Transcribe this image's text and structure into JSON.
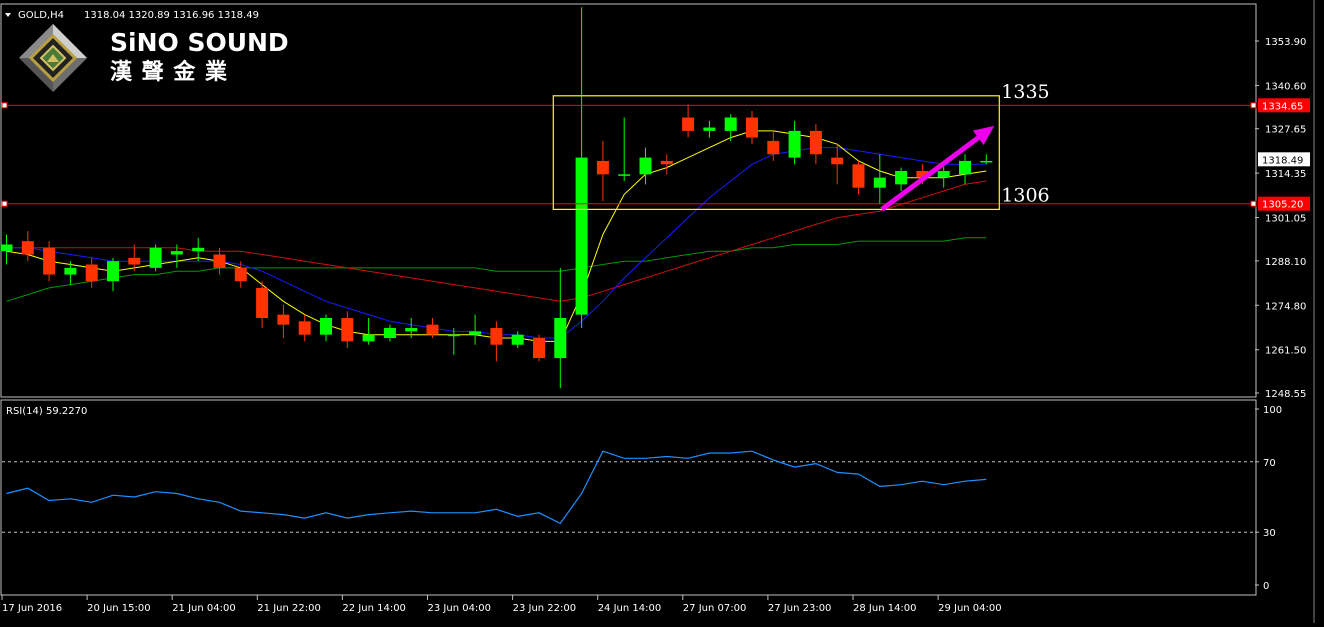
{
  "header": {
    "symbol": "GOLD,H4",
    "ohlc": "1318.04 1320.89 1316.96 1318.49"
  },
  "brand": {
    "name_en": "SiNO SOUND",
    "name_zh": "漢 聲 金 業"
  },
  "colors": {
    "bull": "#00FF00",
    "bear": "#FF3300",
    "ma_fast": "#FFFF00",
    "ma_mid": "#1a1aff",
    "ma_slow": "#CC1111",
    "ma_long": "#009900",
    "rsi": "#1E90FF",
    "hline": "#FF0000",
    "box": "#FFFF00",
    "arrow": "#EE00EE"
  },
  "chart_data": [
    {
      "type": "candlestick",
      "ylim": [
        1243.5,
        1364.0
      ],
      "yticks": [
        1353.9,
        1340.6,
        1327.65,
        1314.35,
        1301.05,
        1288.1,
        1274.8,
        1261.5,
        1248.55
      ],
      "xticks": [
        "17 Jun 2016",
        "20 Jun 15:00",
        "21 Jun 04:00",
        "21 Jun 22:00",
        "22 Jun 14:00",
        "23 Jun 04:00",
        "23 Jun 22:00",
        "24 Jun 14:00",
        "27 Jun 07:00",
        "27 Jun 23:00",
        "28 Jun 14:00",
        "29 Jun 04:00"
      ],
      "current_price": "1318.49",
      "hlines": [
        {
          "value": 1334.65,
          "label": "1334.65"
        },
        {
          "value": 1305.2,
          "label": "1305.20"
        }
      ],
      "annotations": [
        {
          "text": "1335",
          "value": 1337.5
        },
        {
          "text": "1306",
          "value": 1306.5
        }
      ],
      "box": {
        "from_index": 26,
        "to_index": 46,
        "top": 1337.5,
        "bottom": 1303.5
      },
      "arrow": {
        "from_index": 41,
        "from_value": 1303.5,
        "to_index": 46,
        "to_value": 1328.5
      },
      "candles": [
        {
          "o": 1291,
          "h": 1296,
          "l": 1287,
          "c": 1293
        },
        {
          "o": 1294,
          "h": 1297,
          "l": 1288,
          "c": 1290
        },
        {
          "o": 1292,
          "h": 1294,
          "l": 1282,
          "c": 1284
        },
        {
          "o": 1284,
          "h": 1288,
          "l": 1281,
          "c": 1286
        },
        {
          "o": 1287,
          "h": 1289,
          "l": 1280,
          "c": 1282
        },
        {
          "o": 1282,
          "h": 1289,
          "l": 1279,
          "c": 1288
        },
        {
          "o": 1289,
          "h": 1293,
          "l": 1285,
          "c": 1287
        },
        {
          "o": 1286,
          "h": 1293,
          "l": 1285,
          "c": 1292
        },
        {
          "o": 1290,
          "h": 1293,
          "l": 1286,
          "c": 1291
        },
        {
          "o": 1291,
          "h": 1295,
          "l": 1288,
          "c": 1292
        },
        {
          "o": 1290,
          "h": 1292,
          "l": 1284,
          "c": 1286
        },
        {
          "o": 1286,
          "h": 1288,
          "l": 1280,
          "c": 1282
        },
        {
          "o": 1280,
          "h": 1282,
          "l": 1268,
          "c": 1271
        },
        {
          "o": 1272,
          "h": 1275,
          "l": 1265,
          "c": 1269
        },
        {
          "o": 1270,
          "h": 1272,
          "l": 1264,
          "c": 1266
        },
        {
          "o": 1266,
          "h": 1272,
          "l": 1264,
          "c": 1271
        },
        {
          "o": 1271,
          "h": 1273,
          "l": 1262,
          "c": 1264
        },
        {
          "o": 1264,
          "h": 1271,
          "l": 1263,
          "c": 1266
        },
        {
          "o": 1265,
          "h": 1269,
          "l": 1264,
          "c": 1268
        },
        {
          "o": 1267,
          "h": 1271,
          "l": 1265,
          "c": 1268
        },
        {
          "o": 1269,
          "h": 1271,
          "l": 1265,
          "c": 1266
        },
        {
          "o": 1266,
          "h": 1268,
          "l": 1260,
          "c": 1266
        },
        {
          "o": 1266,
          "h": 1272,
          "l": 1263,
          "c": 1267
        },
        {
          "o": 1268,
          "h": 1270,
          "l": 1258,
          "c": 1263
        },
        {
          "o": 1263,
          "h": 1267,
          "l": 1262,
          "c": 1266
        },
        {
          "o": 1265,
          "h": 1266,
          "l": 1258,
          "c": 1259
        },
        {
          "o": 1259,
          "h": 1286,
          "l": 1250,
          "c": 1271
        },
        {
          "o": 1272,
          "h": 1364,
          "l": 1268,
          "c": 1319
        },
        {
          "o": 1318,
          "h": 1324,
          "l": 1306,
          "c": 1314
        },
        {
          "o": 1314,
          "h": 1331,
          "l": 1312,
          "c": 1314
        },
        {
          "o": 1314,
          "h": 1322,
          "l": 1311,
          "c": 1319
        },
        {
          "o": 1318,
          "h": 1320,
          "l": 1314,
          "c": 1317
        },
        {
          "o": 1331,
          "h": 1335,
          "l": 1325,
          "c": 1327
        },
        {
          "o": 1327,
          "h": 1330,
          "l": 1325,
          "c": 1328
        },
        {
          "o": 1327,
          "h": 1332,
          "l": 1324,
          "c": 1331
        },
        {
          "o": 1331,
          "h": 1333,
          "l": 1323,
          "c": 1325
        },
        {
          "o": 1324,
          "h": 1327,
          "l": 1318,
          "c": 1320
        },
        {
          "o": 1319,
          "h": 1330,
          "l": 1317,
          "c": 1327
        },
        {
          "o": 1327,
          "h": 1329,
          "l": 1317,
          "c": 1320
        },
        {
          "o": 1319,
          "h": 1323,
          "l": 1311,
          "c": 1317
        },
        {
          "o": 1317,
          "h": 1318,
          "l": 1308,
          "c": 1310
        },
        {
          "o": 1310,
          "h": 1320,
          "l": 1305,
          "c": 1313
        },
        {
          "o": 1311,
          "h": 1316,
          "l": 1309,
          "c": 1315
        },
        {
          "o": 1315,
          "h": 1317,
          "l": 1311,
          "c": 1313
        },
        {
          "o": 1313,
          "h": 1318,
          "l": 1310,
          "c": 1315
        },
        {
          "o": 1314,
          "h": 1320,
          "l": 1311,
          "c": 1318
        },
        {
          "o": 1318,
          "h": 1320,
          "l": 1317,
          "c": 1318
        }
      ],
      "ma_fast": [
        1291,
        1290,
        1288,
        1287,
        1286,
        1285,
        1286,
        1287,
        1288,
        1289,
        1288,
        1286,
        1281,
        1276,
        1272,
        1269,
        1267,
        1266,
        1266,
        1266,
        1266,
        1266,
        1266,
        1265,
        1265,
        1264,
        1264,
        1278,
        1296,
        1308,
        1314,
        1316,
        1319,
        1322,
        1325,
        1327,
        1327,
        1326,
        1325,
        1323,
        1318,
        1315,
        1313,
        1313,
        1313,
        1314,
        1315
      ],
      "ma_mid": [
        1292,
        1292,
        1291,
        1290,
        1289,
        1288,
        1288,
        1288,
        1288,
        1288,
        1288,
        1287,
        1285,
        1282,
        1279,
        1276,
        1274,
        1272,
        1270,
        1269,
        1268,
        1267,
        1267,
        1266,
        1266,
        1265,
        1265,
        1270,
        1276,
        1283,
        1289,
        1295,
        1301,
        1307,
        1312,
        1317,
        1320,
        1321,
        1322,
        1322,
        1321,
        1320,
        1319,
        1318,
        1317,
        1317,
        1317
      ],
      "ma_slow": [
        1292,
        1292,
        1292,
        1292,
        1292,
        1292,
        1292,
        1292,
        1292,
        1291,
        1291,
        1291,
        1290,
        1289,
        1288,
        1287,
        1286,
        1285,
        1284,
        1283,
        1282,
        1281,
        1280,
        1279,
        1278,
        1277,
        1276,
        1277,
        1279,
        1281,
        1283,
        1285,
        1287,
        1289,
        1291,
        1293,
        1295,
        1297,
        1299,
        1301,
        1302,
        1303,
        1305,
        1307,
        1309,
        1311,
        1312
      ],
      "ma_long": [
        1276,
        1278,
        1280,
        1281,
        1282,
        1283,
        1284,
        1284,
        1285,
        1285,
        1286,
        1286,
        1286,
        1286,
        1286,
        1286,
        1286,
        1286,
        1286,
        1286,
        1286,
        1286,
        1286,
        1285,
        1285,
        1285,
        1285,
        1286,
        1287,
        1288,
        1288,
        1289,
        1290,
        1291,
        1291,
        1292,
        1292,
        1293,
        1293,
        1293,
        1294,
        1294,
        1294,
        1294,
        1294,
        1295,
        1295
      ]
    },
    {
      "type": "line",
      "title": "RSI(14) 59.2270",
      "ylim": [
        -5,
        100
      ],
      "yticks": [
        100,
        70,
        30,
        0
      ],
      "levels": [
        70,
        30
      ],
      "values": [
        52,
        55,
        48,
        49,
        47,
        51,
        50,
        53,
        52,
        49,
        47,
        42,
        41,
        40,
        38,
        41,
        38,
        40,
        41,
        42,
        41,
        41,
        41,
        43,
        39,
        41,
        35,
        52,
        76,
        72,
        72,
        73,
        72,
        75,
        75,
        76,
        71,
        67,
        69,
        64,
        63,
        56,
        57,
        59,
        57,
        59,
        60
      ]
    }
  ]
}
